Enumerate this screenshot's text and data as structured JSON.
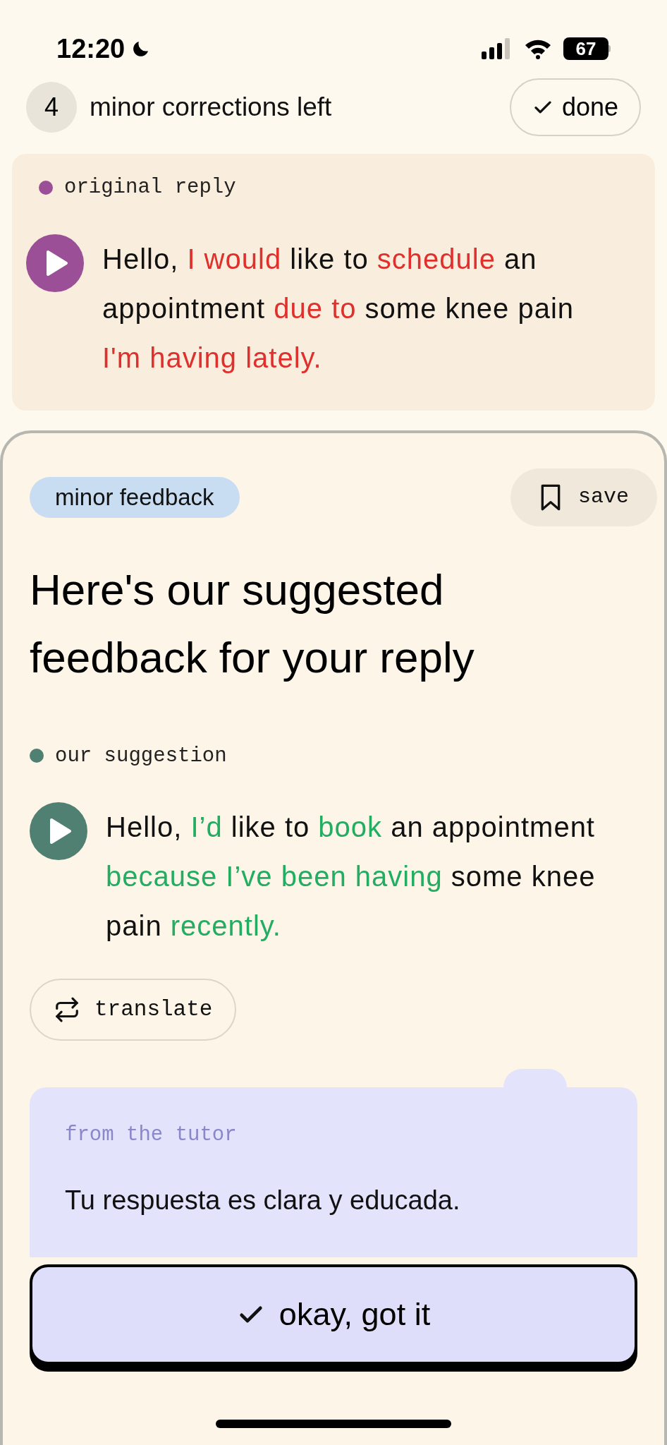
{
  "status_bar": {
    "time": "12:20",
    "battery": "67"
  },
  "header": {
    "count": "4",
    "label": "minor corrections left",
    "done_button": "done"
  },
  "original_reply": {
    "label": "original reply",
    "color": "#9b4f96",
    "segments": [
      {
        "text": "Hello, ",
        "changed": false
      },
      {
        "text": "I would",
        "changed": true
      },
      {
        "text": " like to ",
        "changed": false
      },
      {
        "text": "schedule",
        "changed": true
      },
      {
        "text": " an appointment ",
        "changed": false
      },
      {
        "text": "due to",
        "changed": true
      },
      {
        "text": " some knee pain ",
        "changed": false
      },
      {
        "text": "I'm having lately.",
        "changed": true
      }
    ]
  },
  "feedback": {
    "badge": "minor feedback",
    "save_button": "save",
    "title": "Here's our suggested feedback for your reply",
    "suggestion": {
      "label": "our suggestion",
      "color": "#4f8071",
      "segments": [
        {
          "text": "Hello, ",
          "changed": false
        },
        {
          "text": "I’d",
          "changed": true
        },
        {
          "text": " like to ",
          "changed": false
        },
        {
          "text": "book",
          "changed": true
        },
        {
          "text": " an appointment ",
          "changed": false
        },
        {
          "text": "because I’ve been having",
          "changed": true
        },
        {
          "text": " some knee pain ",
          "changed": false
        },
        {
          "text": "recently.",
          "changed": true
        }
      ]
    },
    "translate_button": "translate",
    "tutor": {
      "label": "from the tutor",
      "text": "Tu respuesta es clara y educada."
    }
  },
  "confirm_button": "okay, got it"
}
